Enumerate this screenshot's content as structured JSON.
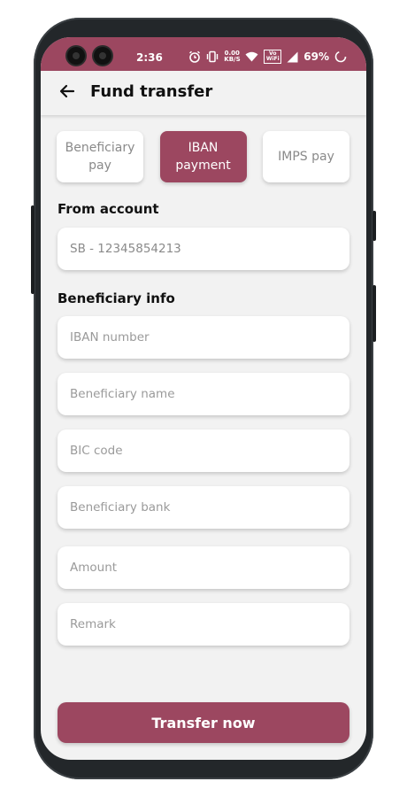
{
  "colors": {
    "accent": "#9c4760",
    "background": "#f2f2f2",
    "card": "#ffffff"
  },
  "status_bar": {
    "time": "2:36",
    "net_speed": "0.00 KB/S",
    "wifi_badge": "Vo WiFi",
    "battery": "69%",
    "icons": [
      "alarm-icon",
      "vibrate-icon",
      "wifi-icon",
      "signal-icon",
      "battery-icon"
    ]
  },
  "app_bar": {
    "title": "Fund transfer",
    "back_icon": "arrow-left-icon"
  },
  "tabs": [
    {
      "label": "Beneficiary pay",
      "active": false
    },
    {
      "label": "IBAN payment",
      "active": true
    },
    {
      "label": "IMPS pay",
      "active": false
    }
  ],
  "from_account": {
    "label": "From account",
    "value": "SB - 12345854213"
  },
  "beneficiary_info": {
    "label": "Beneficiary info",
    "fields": {
      "iban": "IBAN number",
      "name": "Beneficiary name",
      "bic": "BIC code",
      "bank": "Beneficiary bank",
      "amount": "Amount",
      "remark": "Remark"
    }
  },
  "submit_label": "Transfer now"
}
